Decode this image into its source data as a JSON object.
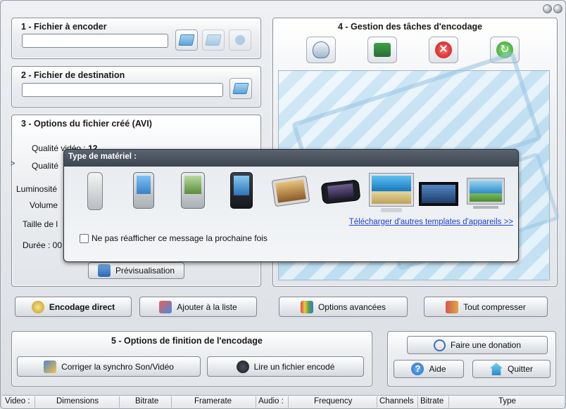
{
  "section1": {
    "title": "1 - Fichier à encoder",
    "value": ""
  },
  "section2": {
    "title": "2 - Fichier de destination",
    "value": ""
  },
  "section3": {
    "title": "3 - Options du fichier créé (AVI)",
    "quality_video_label": "Qualité vidéo :",
    "quality_video_value": "12",
    "quality_label": "Qualité",
    "luminosity_label": "Luminosité",
    "volume_label": "Volume",
    "size_label": "Taille de l",
    "duration_label": "Durée : 00",
    "preview_button": "Prévisualisation",
    "side_marker": ">"
  },
  "section4": {
    "title": "4 - Gestion des tâches d'encodage"
  },
  "popup": {
    "title": "Type de matériel :",
    "devices": [
      "phone",
      "pda",
      "pda",
      "pda",
      "photo-frame",
      "portable-player",
      "monitor",
      "widescreen-tv",
      "flat-tv"
    ],
    "link": "Télécharger d'autres templates d'appareils >>",
    "checkbox_label": "Ne pas réafficher ce message la prochaine fois"
  },
  "actions": {
    "encode_direct": "Encodage direct",
    "add_to_list": "Ajouter à la liste",
    "advanced_options": "Options avancées",
    "compress_all": "Tout compresser"
  },
  "section5": {
    "title": "5 - Options de finition de l'encodage",
    "fix_sync": "Corriger la synchro Son/Vidéo",
    "read_file": "Lire un fichier encodé"
  },
  "misc": {
    "donation": "Faire une donation",
    "help": "Aide",
    "quit": "Quitter"
  },
  "status": {
    "video": "Video :",
    "dimensions": "Dimensions",
    "bitrate1": "Bitrate",
    "framerate": "Framerate",
    "audio": "Audio :",
    "frequency": "Frequency",
    "channels": "Channels",
    "bitrate2": "Bitrate",
    "type": "Type"
  }
}
